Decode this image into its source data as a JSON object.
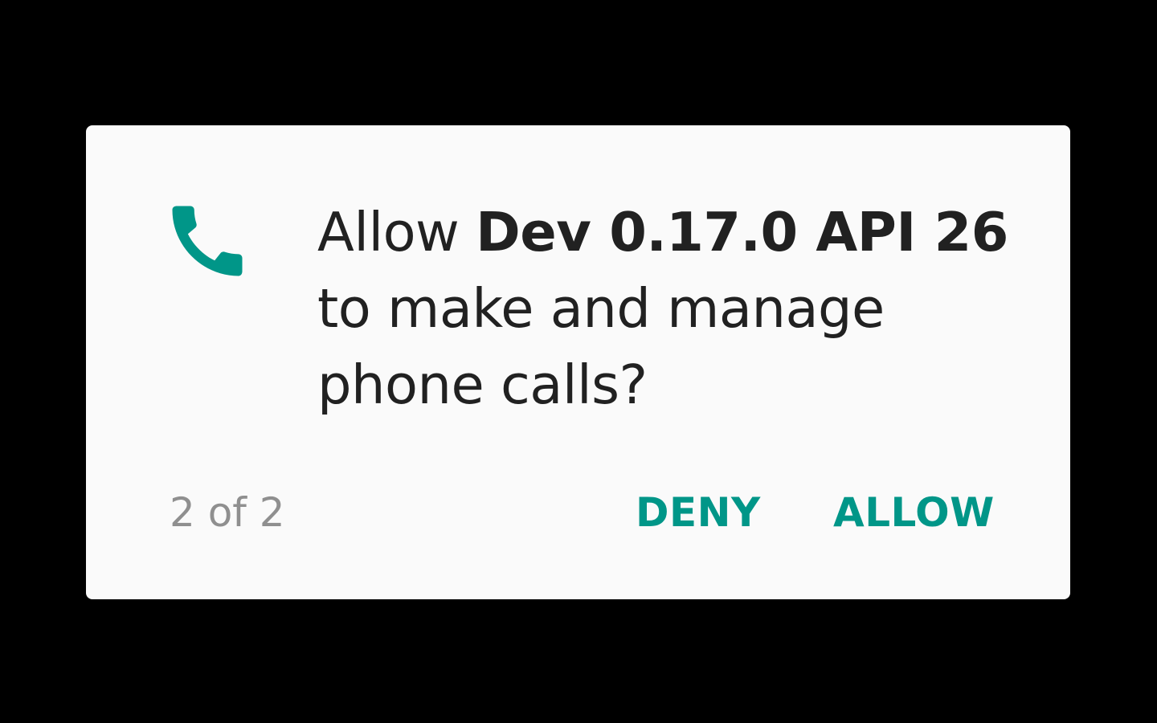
{
  "colors": {
    "accent": "#009688",
    "dialog_background": "#fafafa",
    "scrim": "#000000",
    "message_text": "#212121",
    "counter_text": "#8f8f8f"
  },
  "dialog": {
    "icon": "phone-icon",
    "message": {
      "prefix": "Allow ",
      "app_name": "Dev 0.17.0 API 26",
      "suffix": " to make and manage phone calls?"
    },
    "counter": "2 of 2",
    "buttons": {
      "deny": "DENY",
      "allow": "ALLOW"
    }
  }
}
